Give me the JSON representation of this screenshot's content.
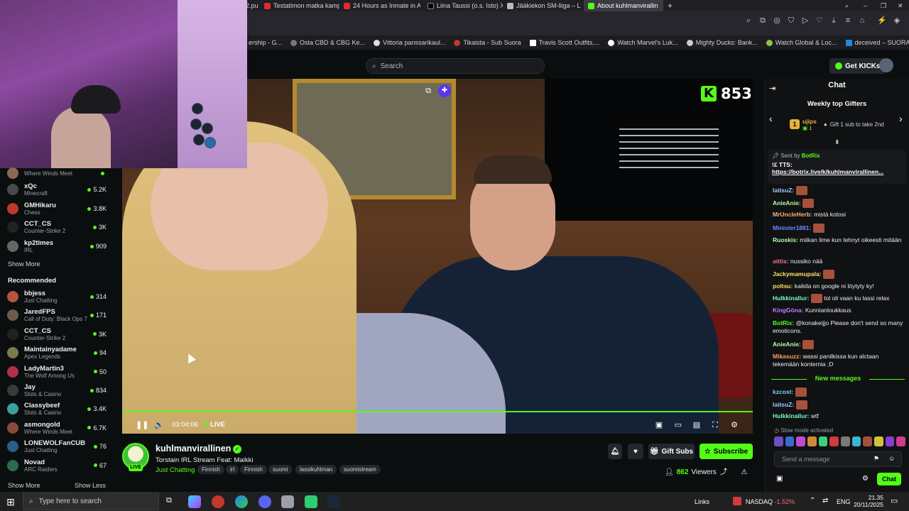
{
  "browser": {
    "tabs": [
      {
        "label": "2.pu",
        "active": false
      },
      {
        "label": "Testatimon matka kamp",
        "active": false
      },
      {
        "label": "24 Hours as Inmate in Ati",
        "active": false
      },
      {
        "label": "Liina Taussi (o.s. Isto) Xss",
        "active": false
      },
      {
        "label": "Jääkiekon SM-liiga – Liiga",
        "active": false
      },
      {
        "label": "About kuhlmanvirallin",
        "active": true
      }
    ],
    "bookmarks": [
      "ership - G...",
      "Osta CBD & CBG Ke...",
      "Vittoria panssarikaul...",
      "Tikaista - Sub Suora",
      "Travis Scott Outfits,...",
      "Watch Marvel's Luk...",
      "Mighty Ducks: Bank...",
      "Watch Global & Loc...",
      "deceived – SUORAT..."
    ]
  },
  "header": {
    "search_placeholder": "Search",
    "get_kicks_label": "Get KICKs"
  },
  "sidebar": {
    "following": [
      {
        "name": "",
        "category": "Where Winds Meet",
        "viewers": "",
        "color": "#8a6a55"
      },
      {
        "name": "xQc",
        "category": "Minecraft",
        "viewers": "5.2K",
        "color": "#4a4a4a"
      },
      {
        "name": "GMHikaru",
        "category": "Chess",
        "viewers": "3.8K",
        "color": "#c0392b"
      },
      {
        "name": "CCT_CS",
        "category": "Counter-Strike 2",
        "viewers": "3K",
        "color": "#222"
      },
      {
        "name": "kp2times",
        "category": "IRL",
        "viewers": "909",
        "color": "#666"
      }
    ],
    "show_more": "Show More",
    "recommended_heading": "Recommended",
    "recommended": [
      {
        "name": "bbjess",
        "category": "Just Chatting",
        "viewers": "314",
        "color": "#b5553f"
      },
      {
        "name": "JaredFPS",
        "category": "Call of Duty: Black Ops 7",
        "viewers": "171",
        "color": "#6d5a4a"
      },
      {
        "name": "CCT_CS",
        "category": "Counter-Strike 2",
        "viewers": "3K",
        "color": "#222"
      },
      {
        "name": "Maintainyadame",
        "category": "Apex Legends",
        "viewers": "94",
        "color": "#7a7a4a"
      },
      {
        "name": "LadyMartin3",
        "category": "The Wolf Among Us",
        "viewers": "50",
        "color": "#b02f4a"
      },
      {
        "name": "Jay",
        "category": "Slots & Casino",
        "viewers": "834",
        "color": "#3a3a3a"
      },
      {
        "name": "Classybeef",
        "category": "Slots & Casino",
        "viewers": "3.4K",
        "color": "#3aa0a0"
      },
      {
        "name": "asmongold",
        "category": "Where Winds Meet",
        "viewers": "6.7K",
        "color": "#8a4a3a"
      },
      {
        "name": "LONEWOLFanCUB",
        "category": "Just Chatting",
        "viewers": "76",
        "color": "#2b5c8a"
      },
      {
        "name": "Novad",
        "category": "ARC Raiders",
        "viewers": "67",
        "color": "#2f6a4f"
      }
    ],
    "show_more_bottom": "Show More",
    "show_less": "Show Less"
  },
  "video": {
    "viewer_badge": "853",
    "time": "03:04:06",
    "live": "LIVE",
    "progress": 1.0
  },
  "stream": {
    "name": "kuhlmanvirallinen",
    "live_badge": "LIVE",
    "title": "Torstain IRL Stream Feat: Maikki",
    "category": "Just Chatting",
    "tags": [
      "Finnish",
      "irl",
      "Finnish",
      "suomi",
      "lassikuhlman",
      "suomistream"
    ],
    "gift_subs": "Gift Subs",
    "subscribe": "Subscribe",
    "viewers_count": "862",
    "viewers_label": "Viewers"
  },
  "chat": {
    "title": "Chat",
    "gifters_title": "Weekly top Gifters",
    "gifter_name": "ujips",
    "gifter_rank": "1",
    "gifter_count": "1",
    "gifter_text": "Gift 1 sub to take 2nd",
    "pinned_by_prefix": "Sent by",
    "pinned_by": "BotRix",
    "pinned_msg": "!£ TTS:",
    "pinned_link": "https://botrix.live/k/kuhlmanvirallinen...",
    "messages": [
      {
        "user": "laitsuZ:",
        "text": "",
        "color": "#a5c8ff",
        "emote": true
      },
      {
        "user": "AnieAnie:",
        "text": "",
        "color": "#b6ffa5",
        "emote": true
      },
      {
        "user": "MrUncleHerb:",
        "text": "mistä kotosi",
        "color": "#ffb07a",
        "emote": false
      },
      {
        "user": "Minister1881:",
        "text": "",
        "color": "#6b8cff",
        "emote": true
      },
      {
        "user": "Ruoskis:",
        "text": "miikan lime kun tehnyt oikeesti mitään",
        "color": "#b6ffa5",
        "emote": false
      },
      {
        "user": "aittis:",
        "text": "nussiko nää",
        "color": "#ff6b9a",
        "emote": false
      },
      {
        "user": "Jackymamupala:",
        "text": "",
        "color": "#ffe066",
        "emote": true
      },
      {
        "user": "poltsu:",
        "text": "kaikila on google ni löytyty ky!",
        "color": "#ffe066",
        "emote": false
      },
      {
        "user": "Hulkkinallur:",
        "text": "tol oli vaan ku lassi relax",
        "color": "#7affc0",
        "emote": true
      },
      {
        "user": "KingGöna:",
        "text": "Kunnianloukkaus",
        "color": "#c77aff",
        "emote": false
      },
      {
        "user": "BotRix:",
        "text": "@konakeijjo Please don't send so many emoticons.",
        "color": "#53fc18",
        "emote": false
      },
      {
        "user": "AnieAnie:",
        "text": "",
        "color": "#b6ffa5",
        "emote": true
      },
      {
        "user": "Mikasuzz:",
        "text": "wassi panilkissa kun alctaan tekemään konternia ;D",
        "color": "#ff9e6b",
        "emote": false
      }
    ],
    "new_messages": "New messages",
    "new_msgs": [
      {
        "user": "kzcost:",
        "text": "",
        "color": "#7ad1ff",
        "emote": true
      },
      {
        "user": "laitsuZ:",
        "text": "",
        "color": "#a5c8ff",
        "emote": true
      },
      {
        "user": "Hulkkinallur:",
        "text": "wtf",
        "color": "#7affc0",
        "emote": false
      }
    ],
    "slow_mode": "Slow mode activated",
    "input_placeholder": "Send a message",
    "send_label": "Chat"
  },
  "taskbar": {
    "search_placeholder": "Type here to search",
    "links": "Links",
    "nasdaq": "NASDAQ",
    "nasdaq_change": "-1.52%",
    "lang": "ENG",
    "time": "21.35",
    "date": "20/11/2025"
  },
  "colors": {
    "accent": "#53fc18",
    "bg": "#0b0e0f"
  }
}
